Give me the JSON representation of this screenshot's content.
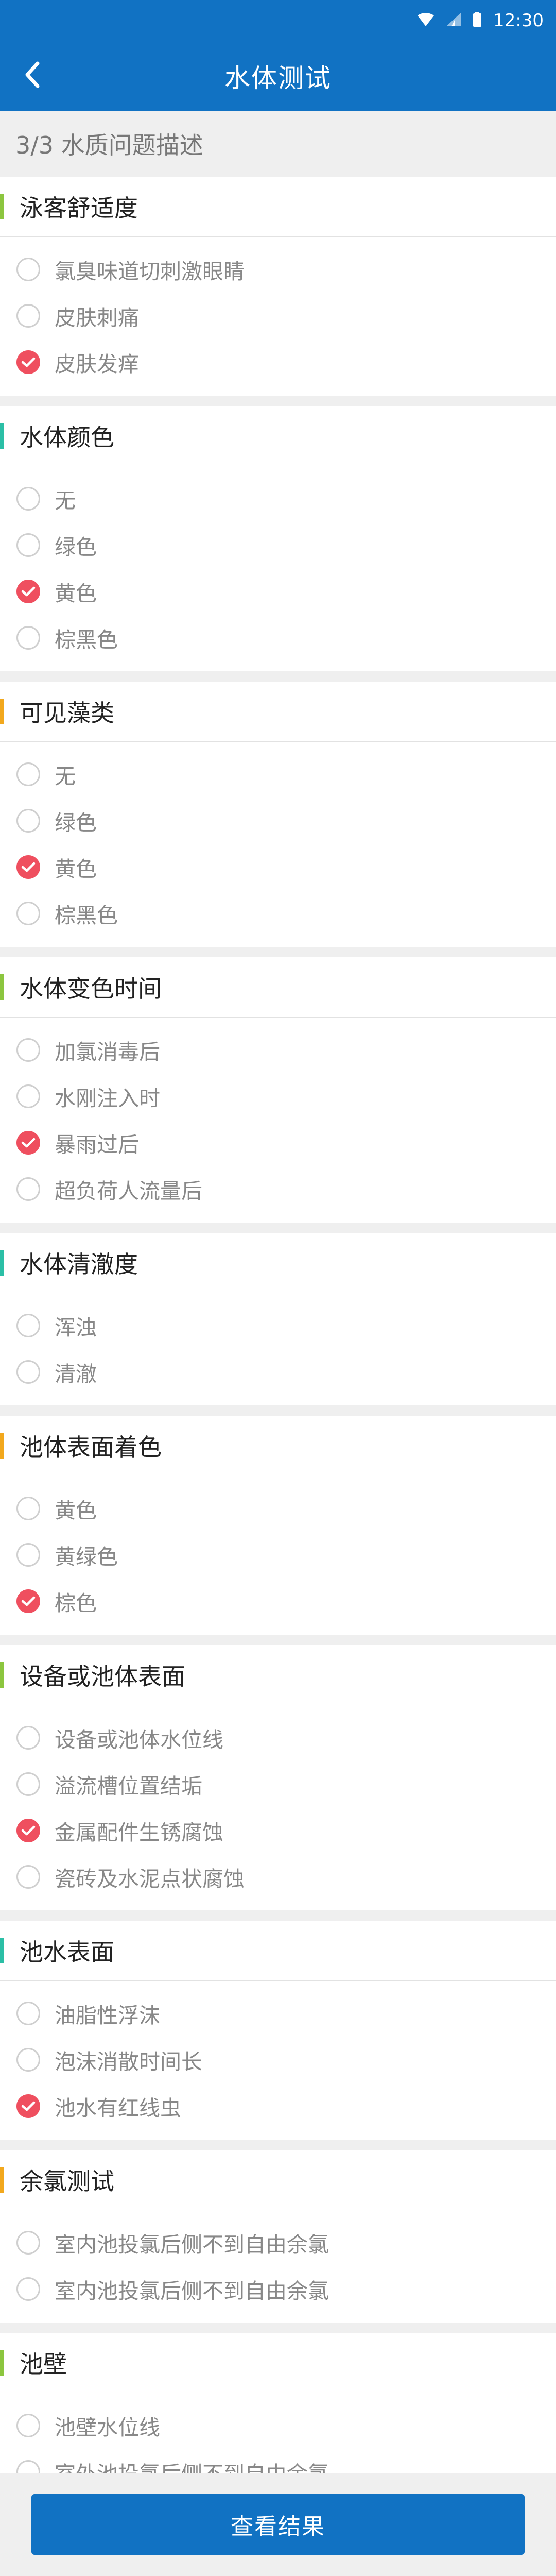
{
  "status_bar": {
    "time": "12:30"
  },
  "header": {
    "title": "水体测试"
  },
  "step": "3/3 水质问题描述",
  "colors": {
    "primary": "#1172c3",
    "check": "#ef4f5f",
    "accent_green": "#8cc63f",
    "accent_teal": "#2bbfa6",
    "accent_orange": "#f2a81d"
  },
  "sections": [
    {
      "title": "泳客舒适度",
      "accent": "#8cc63f",
      "options": [
        {
          "label": "氯臭味道切刺激眼睛",
          "checked": false
        },
        {
          "label": "皮肤刺痛",
          "checked": false
        },
        {
          "label": "皮肤发痒",
          "checked": true
        }
      ]
    },
    {
      "title": "水体颜色",
      "accent": "#2bbfa6",
      "options": [
        {
          "label": "无",
          "checked": false
        },
        {
          "label": "绿色",
          "checked": false
        },
        {
          "label": "黄色",
          "checked": true
        },
        {
          "label": "棕黑色",
          "checked": false
        }
      ]
    },
    {
      "title": "可见藻类",
      "accent": "#f2a81d",
      "options": [
        {
          "label": "无",
          "checked": false
        },
        {
          "label": "绿色",
          "checked": false
        },
        {
          "label": "黄色",
          "checked": true
        },
        {
          "label": "棕黑色",
          "checked": false
        }
      ]
    },
    {
      "title": "水体变色时间",
      "accent": "#8cc63f",
      "options": [
        {
          "label": "加氯消毒后",
          "checked": false
        },
        {
          "label": "水刚注入时",
          "checked": false
        },
        {
          "label": "暴雨过后",
          "checked": true
        },
        {
          "label": "超负荷人流量后",
          "checked": false
        }
      ]
    },
    {
      "title": "水体清澈度",
      "accent": "#2bbfa6",
      "options": [
        {
          "label": "浑浊",
          "checked": false
        },
        {
          "label": "清澈",
          "checked": false
        }
      ]
    },
    {
      "title": "池体表面着色",
      "accent": "#f2a81d",
      "options": [
        {
          "label": "黄色",
          "checked": false
        },
        {
          "label": "黄绿色",
          "checked": false
        },
        {
          "label": "棕色",
          "checked": true
        }
      ]
    },
    {
      "title": "设备或池体表面",
      "accent": "#8cc63f",
      "options": [
        {
          "label": "设备或池体水位线",
          "checked": false
        },
        {
          "label": "溢流槽位置结垢",
          "checked": false
        },
        {
          "label": "金属配件生锈腐蚀",
          "checked": true
        },
        {
          "label": "瓷砖及水泥点状腐蚀",
          "checked": false
        }
      ]
    },
    {
      "title": "池水表面",
      "accent": "#2bbfa6",
      "options": [
        {
          "label": "油脂性浮沫",
          "checked": false
        },
        {
          "label": "泡沫消散时间长",
          "checked": false
        },
        {
          "label": "池水有红线虫",
          "checked": true
        }
      ]
    },
    {
      "title": "余氯测试",
      "accent": "#f2a81d",
      "options": [
        {
          "label": "室内池投氯后侧不到自由余氯",
          "checked": false
        },
        {
          "label": "室内池投氯后侧不到自由余氯",
          "checked": false
        }
      ]
    },
    {
      "title": "池壁",
      "accent": "#8cc63f",
      "options": [
        {
          "label": "池壁水位线",
          "checked": false
        },
        {
          "label": "室外池投氯后侧不到自由余氯",
          "checked": false
        }
      ]
    }
  ],
  "footer": {
    "button_label": "查看结果"
  }
}
